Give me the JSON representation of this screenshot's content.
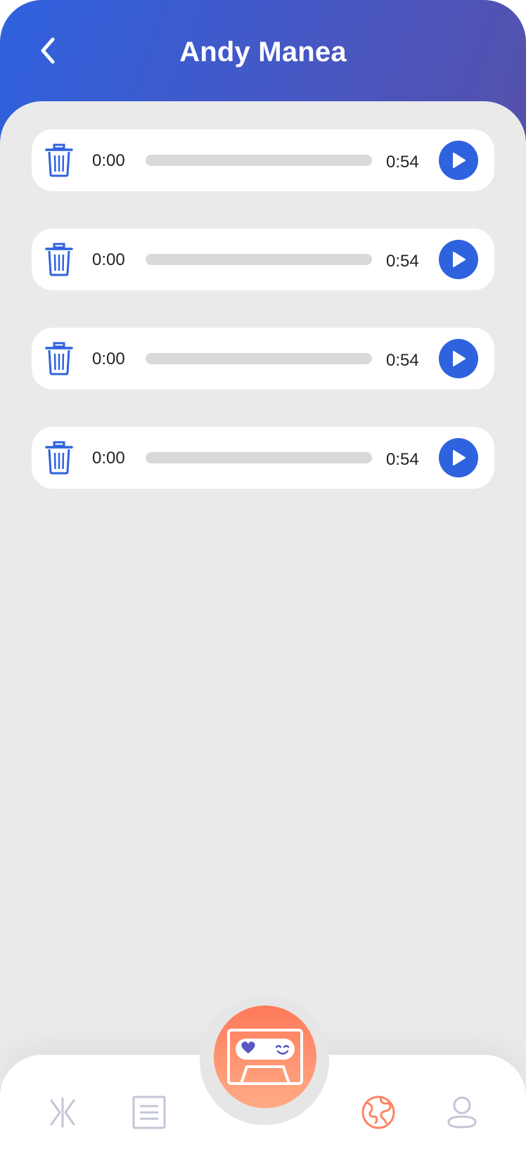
{
  "header": {
    "title": "Andy Manea",
    "back_icon": "chevron-left-icon",
    "gradient": [
      "#2f62de",
      "#5650aa"
    ]
  },
  "recordings": [
    {
      "current_time": "0:00",
      "duration": "0:54",
      "progress": 0
    },
    {
      "current_time": "0:00",
      "duration": "0:54",
      "progress": 0
    },
    {
      "current_time": "0:00",
      "duration": "0:54",
      "progress": 0
    },
    {
      "current_time": "0:00",
      "duration": "0:54",
      "progress": 0
    }
  ],
  "row_icons": {
    "delete": "trash-icon",
    "play": "play-icon"
  },
  "tabbar": {
    "tabs": [
      {
        "icon": "matches-icon",
        "active": false
      },
      {
        "icon": "document-list-icon",
        "active": false
      },
      {
        "icon": "cassette-tape-icon",
        "active": false,
        "center": true
      },
      {
        "icon": "globe-icon",
        "active": true
      },
      {
        "icon": "profile-icon",
        "active": false
      }
    ]
  },
  "colors": {
    "accent": "#2f62de",
    "active_tab": "#ff8462",
    "inactive_tab": "#c3c6d6",
    "background": "#eaeaeb"
  }
}
